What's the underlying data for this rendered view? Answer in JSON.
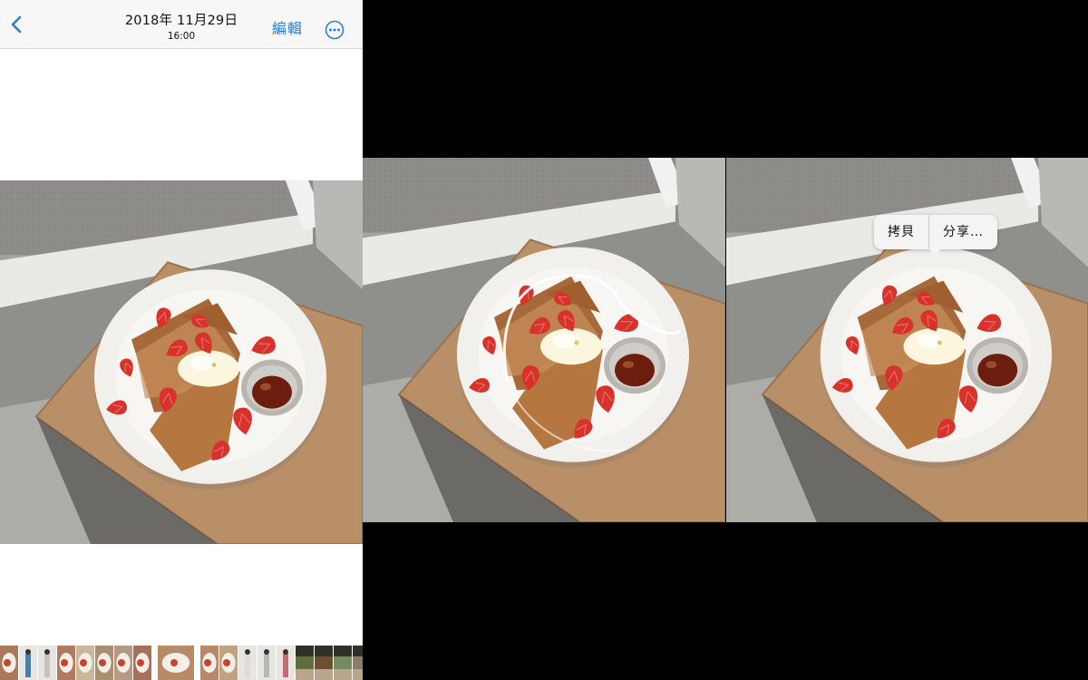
{
  "viewer": {
    "nav": {
      "date": "2018年 11月29日",
      "time": "16:00",
      "edit_label": "編輯",
      "back_icon": "chevron-left-icon",
      "more_icon": "ellipsis-circle-icon"
    },
    "accent_color": "#2a7fd4"
  },
  "photo": {
    "subject": "French toast with strawberries, cream and syrup on a white plate",
    "colors": {
      "plate": "#f2f0ec",
      "table": "#b98f68",
      "toast": "#a8693a",
      "strawberry": "#d8322c",
      "cream": "#fbf6dd",
      "syrup": "#6b1e0e",
      "window_frame": "#e9e9e6",
      "wall": "#a3a3a0",
      "street": "#8e8c88"
    }
  },
  "context_menu": {
    "items": [
      "拷貝",
      "分享…"
    ]
  },
  "filmstrip": {
    "thumbs": [
      {
        "kind": "food",
        "color": "#a87a5a"
      },
      {
        "kind": "person",
        "color": "#4a7fa8"
      },
      {
        "kind": "person",
        "color": "#c9c1b5"
      },
      {
        "kind": "food",
        "color": "#b07a60"
      },
      {
        "kind": "food",
        "color": "#c8b899"
      },
      {
        "kind": "food",
        "color": "#a98e70"
      },
      {
        "kind": "food",
        "color": "#b49a84"
      },
      {
        "kind": "food",
        "color": "#a57158"
      },
      {
        "kind": "selected",
        "color": "#b78b68"
      },
      {
        "kind": "food",
        "color": "#b5896a"
      },
      {
        "kind": "food",
        "color": "#c0a283"
      },
      {
        "kind": "person",
        "color": "#dedad4"
      },
      {
        "kind": "person",
        "color": "#b7b7b4"
      },
      {
        "kind": "person",
        "color": "#c66a7a"
      },
      {
        "kind": "outdoor",
        "color": "#5d6e3c"
      },
      {
        "kind": "outdoor",
        "color": "#6d4f30"
      },
      {
        "kind": "outdoor",
        "color": "#758a62"
      },
      {
        "kind": "outdoor",
        "color": "#8b7c68"
      }
    ]
  }
}
